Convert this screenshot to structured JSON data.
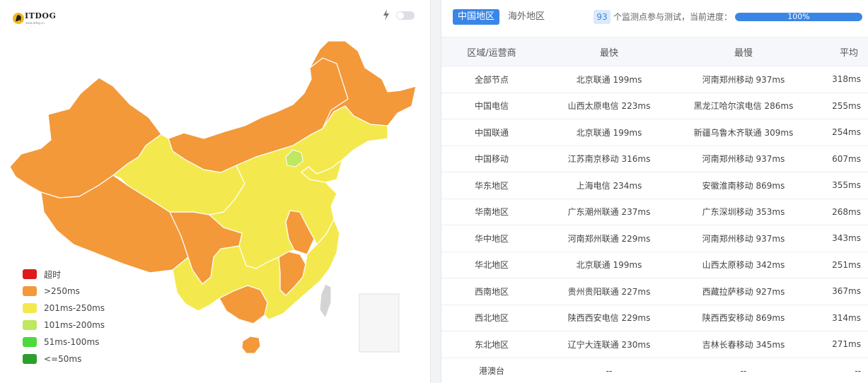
{
  "logo": {
    "text": "ITDOG",
    "subtext": "www.itdog.cn"
  },
  "toolbar": {
    "bolt_icon": "bolt-icon",
    "toggle_state": "off"
  },
  "map": {
    "region": "china",
    "colors": {
      "orange": "#f3993a",
      "yellow": "#f3e94e",
      "lightgreen": "#bde860",
      "gray": "#d4d4d4",
      "border": "#ffffff"
    }
  },
  "legend": {
    "items": [
      {
        "label": "超时",
        "color": "#dd1b1b"
      },
      {
        "label": ">250ms",
        "color": "#f3993a"
      },
      {
        "label": "201ms-250ms",
        "color": "#f3e94e"
      },
      {
        "label": "101ms-200ms",
        "color": "#bde860"
      },
      {
        "label": "51ms-100ms",
        "color": "#4ada3c"
      },
      {
        "label": "<=50ms",
        "color": "#2ca02c"
      }
    ]
  },
  "tabs": {
    "china": "中国地区",
    "overseas": "海外地区",
    "active": "china"
  },
  "progress": {
    "node_count": "93",
    "text": "个监测点参与测试，当前进度：",
    "percent_label": "100%",
    "percent": 100
  },
  "table": {
    "headers": {
      "region": "区域/运营商",
      "fastest": "最快",
      "slowest": "最慢",
      "average": "平均"
    },
    "rows": [
      {
        "region": "全部节点",
        "fastest": "北京联通 199ms",
        "slowest": "河南郑州移动 937ms",
        "average": "318ms"
      },
      {
        "region": "中国电信",
        "fastest": "山西太原电信 223ms",
        "slowest": "黑龙江哈尔滨电信 286ms",
        "average": "255ms"
      },
      {
        "region": "中国联通",
        "fastest": "北京联通 199ms",
        "slowest": "新疆乌鲁木齐联通 309ms",
        "average": "254ms"
      },
      {
        "region": "中国移动",
        "fastest": "江苏南京移动 316ms",
        "slowest": "河南郑州移动 937ms",
        "average": "607ms"
      },
      {
        "region": "华东地区",
        "fastest": "上海电信 234ms",
        "slowest": "安徽淮南移动 869ms",
        "average": "355ms"
      },
      {
        "region": "华南地区",
        "fastest": "广东潮州联通 237ms",
        "slowest": "广东深圳移动 353ms",
        "average": "268ms"
      },
      {
        "region": "华中地区",
        "fastest": "河南郑州联通 229ms",
        "slowest": "河南郑州移动 937ms",
        "average": "343ms"
      },
      {
        "region": "华北地区",
        "fastest": "北京联通 199ms",
        "slowest": "山西太原移动 342ms",
        "average": "251ms"
      },
      {
        "region": "西南地区",
        "fastest": "贵州贵阳联通 227ms",
        "slowest": "西藏拉萨移动 927ms",
        "average": "367ms"
      },
      {
        "region": "西北地区",
        "fastest": "陕西西安电信 229ms",
        "slowest": "陕西西安移动 869ms",
        "average": "314ms"
      },
      {
        "region": "东北地区",
        "fastest": "辽宁大连联通 230ms",
        "slowest": "吉林长春移动 345ms",
        "average": "271ms"
      },
      {
        "region": "港澳台",
        "fastest": "--",
        "slowest": "--",
        "average": "--"
      }
    ]
  }
}
